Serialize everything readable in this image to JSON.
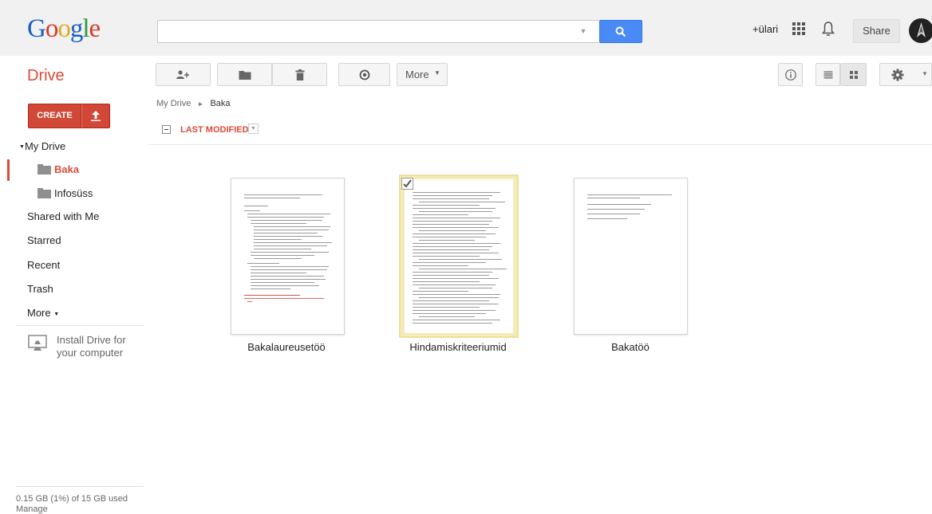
{
  "header": {
    "logo": [
      "G",
      "o",
      "o",
      "g",
      "l",
      "e"
    ],
    "user_name": "+ülari",
    "share_label": "Share"
  },
  "toolbar": {
    "app_title": "Drive",
    "more_label": "More"
  },
  "sidebar": {
    "create_label": "CREATE",
    "my_drive": "My Drive",
    "folders": [
      "Baka",
      "Infosüss"
    ],
    "items": [
      "Shared with Me",
      "Starred",
      "Recent",
      "Trash"
    ],
    "more_label": "More",
    "install_label": "Install Drive for your computer",
    "storage": "0.15 GB (1%) of 15 GB used",
    "manage": "Manage"
  },
  "main": {
    "breadcrumb": [
      "My Drive",
      "Baka"
    ],
    "sort_label": "LAST MODIFIED",
    "files": [
      {
        "name": "Bakalaureusetöö",
        "selected": false
      },
      {
        "name": "Hindamiskriteeriumid",
        "selected": true
      },
      {
        "name": "Bakatöö",
        "selected": false
      }
    ]
  },
  "colors": {
    "accent_red": "#dd4b39",
    "search_blue": "#4a8af4",
    "selected_highlight": "#f4ebb6"
  }
}
